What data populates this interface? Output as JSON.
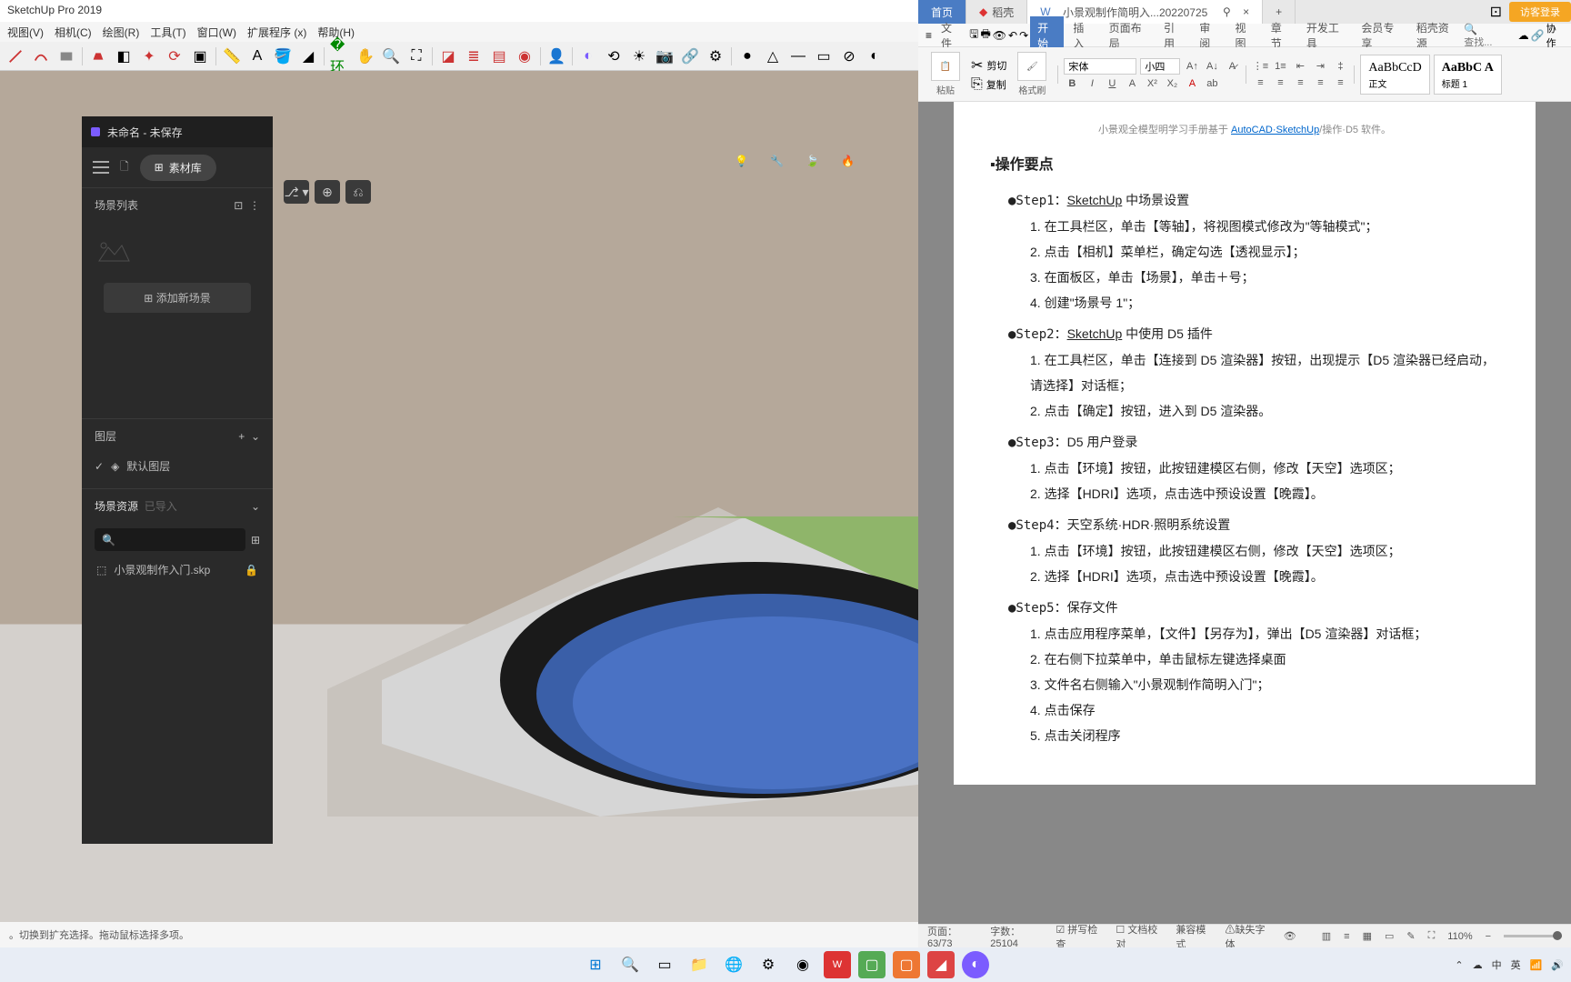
{
  "sketchup": {
    "title": "SketchUp Pro 2019",
    "menu": [
      "视图(V)",
      "相机(C)",
      "绘图(R)",
      "工具(T)",
      "窗口(W)",
      "扩展程序 (x)",
      "帮助(H)"
    ],
    "status": "。切换到扩充选择。拖动鼠标选择多项。"
  },
  "d5": {
    "win_title": "未命名 - 未保存",
    "material_btn": "素材库",
    "scene_list_h": "场景列表",
    "add_scene": "添加新场景",
    "layers_h": "图层",
    "default_layer": "默认图层",
    "assets_h": "场景资源",
    "assets_sub": "已导入",
    "search_ph": "",
    "asset_file": "小景观制作入门.skp"
  },
  "wps": {
    "tabs": {
      "home": "首页",
      "app": "稻壳",
      "doc": "小景观制作简明入...20220725"
    },
    "ribbon_tabs": [
      "文件",
      "开始",
      "插入",
      "页面布局",
      "引用",
      "审阅",
      "视图",
      "章节",
      "开发工具",
      "会员专享",
      "稻壳资源"
    ],
    "search_ph": "查找...",
    "login": "访客登录",
    "clip": {
      "paste": "粘贴",
      "cut": "剪切",
      "copy": "复制",
      "fmt": "格式刷"
    },
    "font": {
      "name": "宋体",
      "size": "小四"
    },
    "styles": {
      "normal": "正文",
      "h1": "标题 1",
      "s1": "AaBbCcD",
      "s2": "AaBbC A"
    },
    "status": {
      "page": "页面：63/73",
      "words": "字数：25104",
      "spell": "拼写检查",
      "proof": "文档校对",
      "compat": "兼容模式",
      "missing": "缺失字体",
      "zoom": "110%"
    }
  },
  "doc": {
    "breadcrumb_pre": "小景观全模型明学习手册基于 ",
    "breadcrumb_link": "AutoCAD·SketchUp",
    "breadcrumb_post": "/操作·D5 软件。",
    "h": "操作要点",
    "s1": {
      "lbl": "●Step1：",
      "t": "SketchUp",
      "rest": " 中场景设置",
      "l1": "1. 在工具栏区，单击【等轴】，将视图模式修改为\"等轴模式\"；",
      "l2": "2. 点击【相机】菜单栏，确定勾选【透视显示】；",
      "l3": "3. 在面板区，单击【场景】，单击＋号；",
      "l4": "4. 创建\"场景号 1\"；"
    },
    "s2": {
      "lbl": "●Step2：",
      "t": "SketchUp",
      "rest": " 中使用 D5 插件",
      "l1": "1. 在工具栏区，单击【连接到 D5 渲染器】按钮，出现提示【D5 渲染器已经启动，请选择】对话框；",
      "l2": "2. 点击【确定】按钮，进入到 D5 渲染器。"
    },
    "s3": {
      "lbl": "●Step3：",
      "t": "D5 用户登录",
      "l1": "1. 点击【环境】按钮，此按钮建模区右侧，修改【天空】选项区；",
      "l2": "2. 选择【HDRI】选项，点击选中预设设置【晚霞】。"
    },
    "s4": {
      "lbl": "●Step4：",
      "t": "天空系统·HDR·照明系统设置",
      "l1": "1. 点击【环境】按钮，此按钮建模区右侧，修改【天空】选项区；",
      "l2": "2. 选择【HDRI】选项，点击选中预设设置【晚霞】。"
    },
    "s5": {
      "lbl": "●Step5：",
      "t": "保存文件",
      "l1": "1. 点击应用程序菜单，【文件】【另存为】，弹出【D5 渲染器】对话框；",
      "l2": "2. 在右侧下拉菜单中，单击鼠标左键选择桌面",
      "l3": "3. 文件名右侧输入\"小景观制作简明入门\"；",
      "l4": "4. 点击保存",
      "l5": "5. 点击关闭程序"
    }
  },
  "tray": {
    "ime": "英",
    "lang": "中"
  }
}
